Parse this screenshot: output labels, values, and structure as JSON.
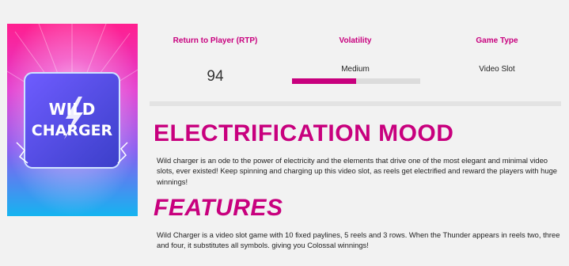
{
  "game_image": {
    "logo_line1": "WILD",
    "logo_line2": "CHARGER"
  },
  "stats": {
    "rtp": {
      "label": "Return to Player (RTP)",
      "value": "94"
    },
    "volatility": {
      "label": "Volatility",
      "value": "Medium",
      "level_percent": 50
    },
    "game_type": {
      "label": "Game Type",
      "value": "Video Slot"
    }
  },
  "sections": {
    "mood": {
      "heading": "ELECTRIFICATION MOOD",
      "text": "Wild charger is an ode to the power of electricity and the elements that drive one of the most elegant and minimal video slots, ever existed! Keep spinning and charging up this video slot, as reels get electrified and reward the players with huge winnings!"
    },
    "features": {
      "heading": "FEATURES",
      "text": "Wild Charger is a video slot game with 10 fixed paylines, 5 reels and 3 rows. When the Thunder appears in reels two, three and four, it substitutes all symbols. giving you Colossal winnings!"
    }
  },
  "colors": {
    "accent": "#c8007e",
    "background": "#f2f2f2",
    "bar_track": "#dcdcdc"
  }
}
